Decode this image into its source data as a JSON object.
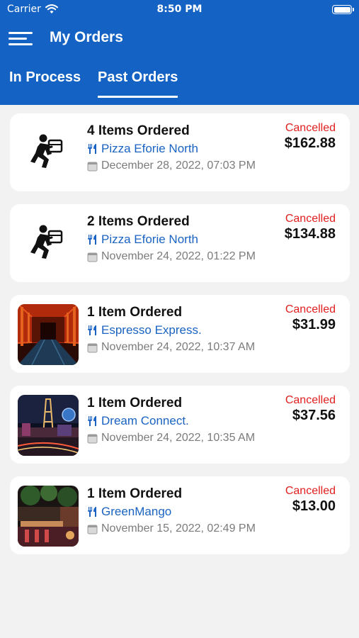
{
  "status_bar": {
    "carrier": "Carrier",
    "time": "8:50 PM"
  },
  "header": {
    "title": "My Orders"
  },
  "tabs": [
    {
      "label": "In Process",
      "active": false
    },
    {
      "label": "Past Orders",
      "active": true
    }
  ],
  "orders": [
    {
      "items": "4 Items Ordered",
      "restaurant": "Pizza Eforie North",
      "date": "December 28, 2022, 07:03 PM",
      "status": "Cancelled",
      "amount": "$162.88",
      "thumb": "delivery-icon"
    },
    {
      "items": "2 Items Ordered",
      "restaurant": "Pizza Eforie North",
      "date": "November 24, 2022, 01:22 PM",
      "status": "Cancelled",
      "amount": "$134.88",
      "thumb": "delivery-icon"
    },
    {
      "items": "1 Item Ordered",
      "restaurant": "Espresso Express.",
      "date": "November 24, 2022, 10:37 AM",
      "status": "Cancelled",
      "amount": "$31.99",
      "thumb": "red-corridor-image"
    },
    {
      "items": "1 Item Ordered",
      "restaurant": "Dream Connect.",
      "date": "November 24, 2022, 10:35 AM",
      "status": "Cancelled",
      "amount": "$37.56",
      "thumb": "las-vegas-night-image"
    },
    {
      "items": "1 Item Ordered",
      "restaurant": "GreenMango",
      "date": "November 15, 2022, 02:49 PM",
      "status": "Cancelled",
      "amount": "$13.00",
      "thumb": "restaurant-interior-image"
    }
  ],
  "colors": {
    "brand_blue": "#1462c4",
    "cancelled_red": "#e02020",
    "link_blue": "#1a63c2"
  }
}
